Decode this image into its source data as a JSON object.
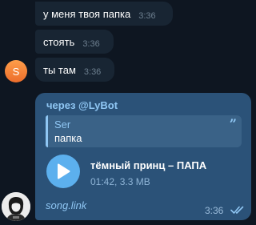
{
  "messages": [
    {
      "text": "у меня твоя папка",
      "time": "3:36"
    },
    {
      "text": "стоять",
      "time": "3:36"
    },
    {
      "text": "ты там",
      "time": "3:36"
    }
  ],
  "sender_avatar_letter": "S",
  "forwarded": {
    "via": "через @LyBot",
    "quote_author": "Ser",
    "quote_text": "папка",
    "quote_mark": "”",
    "track_title": "тёмный принц – ПАПА",
    "track_meta": "01:42, 3.3 MB",
    "link_text": "song.link",
    "time": "3:36",
    "read_status": "read"
  },
  "colors": {
    "background": "#0e1621",
    "incoming_bubble": "#182533",
    "outgoing_bubble": "#2b5278",
    "accent": "#8fc6f3",
    "play_button": "#5cb0ee",
    "avatar": "#ec6d2b"
  },
  "icons": {
    "play": "play-icon",
    "read": "double-check-icon",
    "quote": "quote-icon"
  }
}
